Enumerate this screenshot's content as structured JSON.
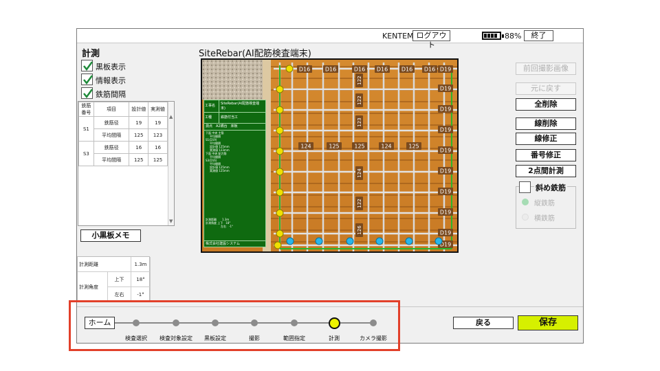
{
  "topbar": {
    "company": "KENTEM",
    "logout": "ログアウト",
    "battery": "88%",
    "exit": "終了"
  },
  "left": {
    "title": "計測",
    "checkboxes": [
      "黒板表示",
      "情報表示",
      "鉄筋間隔"
    ],
    "table": {
      "headers": [
        "鉄筋番号",
        "項目",
        "設計値",
        "実測値"
      ],
      "groups": [
        {
          "id": "S1",
          "rows": [
            [
              "鉄筋径",
              "19",
              "19"
            ],
            [
              "平均間隔",
              "125",
              "123"
            ]
          ]
        },
        {
          "id": "S3",
          "rows": [
            [
              "鉄筋径",
              "16",
              "16"
            ],
            [
              "平均間隔",
              "125",
              "125"
            ]
          ]
        }
      ]
    },
    "memo_button": "小黒板メモ",
    "distance": {
      "label": "計測距離",
      "value": "1.3m",
      "angle_label": "計測角度",
      "ud_label": "上下",
      "ud": "18°",
      "lr_label": "左右",
      "lr": "-1°"
    }
  },
  "app_title": "SiteRebar(AI配筋検査端末)",
  "photo": {
    "board": {
      "r1k": "工事名",
      "r1v": "SiteRebar(AI配筋検査端末)",
      "r2k": "工種",
      "r2v": "鉄筋付当工",
      "r3": "測点　A2橋台　床板",
      "lines": [
        "下面 中央 主筋",
        "平均間隔",
        "S1(D19)",
        "平均間隔",
        "設計値 125mm",
        "実測値 123mm",
        "下面 中央 配力筋",
        "平均間隔",
        "S3(D16)",
        "平均間隔",
        "設計値 125mm",
        "実測値 125mm"
      ],
      "f1": "計測距離　　1.3m",
      "f2": "計測角度 上下　18°",
      "f3": "左右　-1°",
      "company": "株式会社建設システム"
    },
    "top_labels": [
      "D16",
      "D16",
      "D16",
      "D16",
      "D16",
      "D16",
      "D19"
    ],
    "right_labels": [
      "D19",
      "D19",
      "D19",
      "D19",
      "D19",
      "D19",
      "D19",
      "D19",
      "D19",
      "D19"
    ],
    "h_values": [
      "124",
      "125",
      "125",
      "124",
      "125"
    ],
    "v_values": [
      "122",
      "122",
      "123",
      "124",
      "122",
      "126"
    ]
  },
  "right": {
    "prev_photo": "前回撮影画像",
    "undo": "元に戻す",
    "delete_all": "全削除",
    "line_delete": "線削除",
    "line_fix": "線修正",
    "number_fix": "番号修正",
    "two_point": "2点間計測",
    "diagonal": "斜め鉄筋",
    "vertical": "縦鉄筋",
    "horizontal": "横鉄筋"
  },
  "nav": {
    "home": "ホーム",
    "steps": [
      "検査選択",
      "検査対象設定",
      "黒板設定",
      "撮影",
      "範囲指定",
      "計測",
      "カメラ撮影"
    ],
    "back": "戻る",
    "save": "保存"
  },
  "colors": {
    "accent": "#d6f000",
    "check": "#1e8a3a",
    "board": "#0f6a10",
    "highlight": "#e2402a"
  }
}
